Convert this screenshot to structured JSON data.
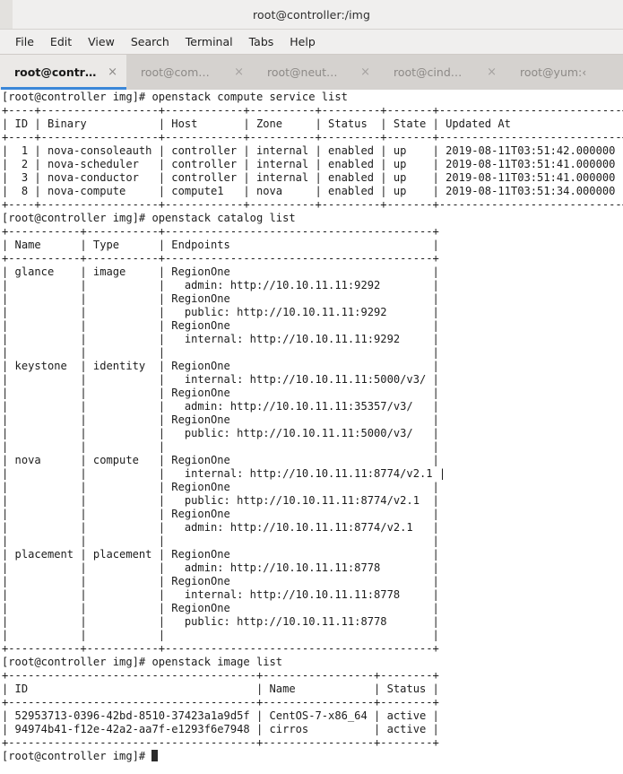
{
  "window": {
    "title": "root@controller:/img"
  },
  "menubar": {
    "items": [
      {
        "label": "File",
        "name": "menu-file"
      },
      {
        "label": "Edit",
        "name": "menu-edit"
      },
      {
        "label": "View",
        "name": "menu-view"
      },
      {
        "label": "Search",
        "name": "menu-search"
      },
      {
        "label": "Terminal",
        "name": "menu-terminal"
      },
      {
        "label": "Tabs",
        "name": "menu-tabs"
      },
      {
        "label": "Help",
        "name": "menu-help"
      }
    ]
  },
  "tabs": {
    "close_glyph": "×",
    "items": [
      {
        "label": "root@contr…",
        "active": true
      },
      {
        "label": "root@com…",
        "active": false
      },
      {
        "label": "root@neut…",
        "active": false
      },
      {
        "label": "root@cind…",
        "active": false
      },
      {
        "label": "root@yum:‹",
        "active": false
      }
    ]
  },
  "terminal": {
    "prompt": "[root@controller img]#",
    "colors": {
      "background": "#ffffff",
      "foreground": "#1c1c1c",
      "cursor": "#2b2b2b",
      "tab_active_underline": "#3b87d8"
    },
    "commands": [
      "openstack compute service list",
      "openstack catalog list",
      "openstack image list"
    ],
    "compute_service_list": {
      "columns": [
        "ID",
        "Binary",
        "Host",
        "Zone",
        "Status",
        "State",
        "Updated At"
      ],
      "rows": [
        [
          "1",
          "nova-consoleauth",
          "controller",
          "internal",
          "enabled",
          "up",
          "2019-08-11T03:51:42.000000"
        ],
        [
          "2",
          "nova-scheduler",
          "controller",
          "internal",
          "enabled",
          "up",
          "2019-08-11T03:51:41.000000"
        ],
        [
          "3",
          "nova-conductor",
          "controller",
          "internal",
          "enabled",
          "up",
          "2019-08-11T03:51:41.000000"
        ],
        [
          "8",
          "nova-compute",
          "compute1",
          "nova",
          "enabled",
          "up",
          "2019-08-11T03:51:34.000000"
        ]
      ]
    },
    "catalog_list": {
      "columns": [
        "Name",
        "Type",
        "Endpoints"
      ],
      "rows": [
        {
          "name": "glance",
          "type": "image",
          "endpoints": [
            {
              "region": "RegionOne",
              "interface": "admin",
              "url": "http://10.10.11.11:9292"
            },
            {
              "region": "RegionOne",
              "interface": "public",
              "url": "http://10.10.11.11:9292"
            },
            {
              "region": "RegionOne",
              "interface": "internal",
              "url": "http://10.10.11.11:9292"
            }
          ]
        },
        {
          "name": "keystone",
          "type": "identity",
          "endpoints": [
            {
              "region": "RegionOne",
              "interface": "internal",
              "url": "http://10.10.11.11:5000/v3/"
            },
            {
              "region": "RegionOne",
              "interface": "admin",
              "url": "http://10.10.11.11:35357/v3/"
            },
            {
              "region": "RegionOne",
              "interface": "public",
              "url": "http://10.10.11.11:5000/v3/"
            }
          ]
        },
        {
          "name": "nova",
          "type": "compute",
          "endpoints": [
            {
              "region": "RegionOne",
              "interface": "internal",
              "url": "http://10.10.11.11:8774/v2.1"
            },
            {
              "region": "RegionOne",
              "interface": "public",
              "url": "http://10.10.11.11:8774/v2.1"
            },
            {
              "region": "RegionOne",
              "interface": "admin",
              "url": "http://10.10.11.11:8774/v2.1"
            }
          ]
        },
        {
          "name": "placement",
          "type": "placement",
          "endpoints": [
            {
              "region": "RegionOne",
              "interface": "admin",
              "url": "http://10.10.11.11:8778"
            },
            {
              "region": "RegionOne",
              "interface": "internal",
              "url": "http://10.10.11.11:8778"
            },
            {
              "region": "RegionOne",
              "interface": "public",
              "url": "http://10.10.11.11:8778"
            }
          ]
        }
      ]
    },
    "image_list": {
      "columns": [
        "ID",
        "Name",
        "Status"
      ],
      "rows": [
        [
          "52953713-0396-42bd-8510-37423a1a9d5f",
          "CentOS-7-x86_64",
          "active"
        ],
        [
          "94974b41-f12e-42a2-aa7f-e1293f6e7948",
          "cirros",
          "active"
        ]
      ]
    },
    "screen_text": "[root@controller img]# openstack compute service list\n+----+------------------+------------+----------+---------+-------+----------------------------+\n| ID | Binary           | Host       | Zone     | Status  | State | Updated At                 |\n+----+------------------+------------+----------+---------+-------+----------------------------+\n|  1 | nova-consoleauth | controller | internal | enabled | up    | 2019-08-11T03:51:42.000000 |\n|  2 | nova-scheduler   | controller | internal | enabled | up    | 2019-08-11T03:51:41.000000 |\n|  3 | nova-conductor   | controller | internal | enabled | up    | 2019-08-11T03:51:41.000000 |\n|  8 | nova-compute     | compute1   | nova     | enabled | up    | 2019-08-11T03:51:34.000000 |\n+----+------------------+------------+----------+---------+-------+----------------------------+\n[root@controller img]# openstack catalog list\n+-----------+-----------+-----------------------------------------+\n| Name      | Type      | Endpoints                               |\n+-----------+-----------+-----------------------------------------+\n| glance    | image     | RegionOne                               |\n|           |           |   admin: http://10.10.11.11:9292        |\n|           |           | RegionOne                               |\n|           |           |   public: http://10.10.11.11:9292       |\n|           |           | RegionOne                               |\n|           |           |   internal: http://10.10.11.11:9292     |\n|           |           |                                         |\n| keystone  | identity  | RegionOne                               |\n|           |           |   internal: http://10.10.11.11:5000/v3/ |\n|           |           | RegionOne                               |\n|           |           |   admin: http://10.10.11.11:35357/v3/   |\n|           |           | RegionOne                               |\n|           |           |   public: http://10.10.11.11:5000/v3/   |\n|           |           |                                         |\n| nova      | compute   | RegionOne                               |\n|           |           |   internal: http://10.10.11.11:8774/v2.1 |\n|           |           | RegionOne                               |\n|           |           |   public: http://10.10.11.11:8774/v2.1  |\n|           |           | RegionOne                               |\n|           |           |   admin: http://10.10.11.11:8774/v2.1   |\n|           |           |                                         |\n| placement | placement | RegionOne                               |\n|           |           |   admin: http://10.10.11.11:8778        |\n|           |           | RegionOne                               |\n|           |           |   internal: http://10.10.11.11:8778     |\n|           |           | RegionOne                               |\n|           |           |   public: http://10.10.11.11:8778       |\n|           |           |                                         |\n+-----------+-----------+-----------------------------------------+\n[root@controller img]# openstack image list\n+--------------------------------------+-----------------+--------+\n| ID                                   | Name            | Status |\n+--------------------------------------+-----------------+--------+\n| 52953713-0396-42bd-8510-37423a1a9d5f | CentOS-7-x86_64 | active |\n| 94974b41-f12e-42a2-aa7f-e1293f6e7948 | cirros          | active |\n+--------------------------------------+-----------------+--------+\n[root@controller img]# "
  }
}
